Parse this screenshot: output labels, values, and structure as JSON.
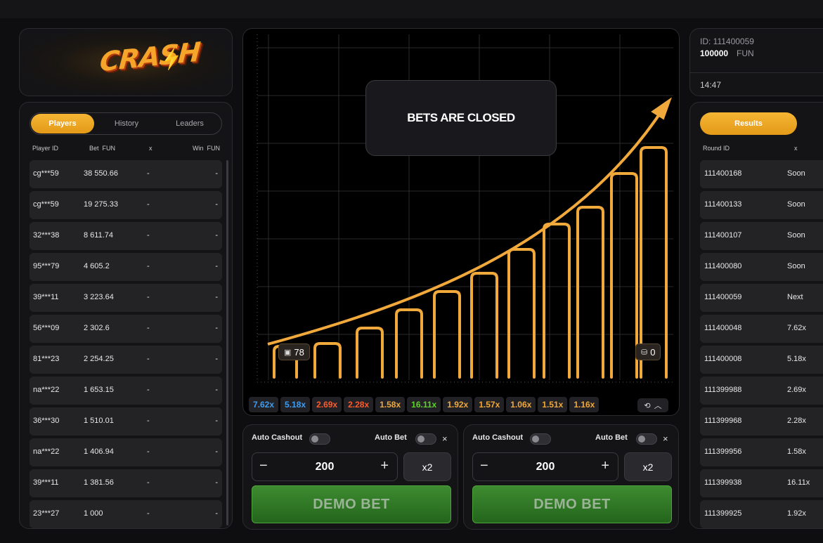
{
  "logo": {
    "text": "CRASH"
  },
  "players": {
    "tabs": [
      {
        "label": "Players",
        "active": true
      },
      {
        "label": "History",
        "active": false
      },
      {
        "label": "Leaders",
        "active": false
      }
    ],
    "headers": {
      "player_id": "Player ID",
      "bet": "Bet  FUN",
      "x": "x",
      "win": "Win  FUN"
    },
    "rows": [
      {
        "id": "cg***59",
        "bet": "38 550.66",
        "x": "-",
        "win": "-"
      },
      {
        "id": "cg***59",
        "bet": "19 275.33",
        "x": "-",
        "win": "-"
      },
      {
        "id": "32***38",
        "bet": "8 611.74",
        "x": "-",
        "win": "-"
      },
      {
        "id": "95***79",
        "bet": "4 605.2",
        "x": "-",
        "win": "-"
      },
      {
        "id": "39***11",
        "bet": "3 223.64",
        "x": "-",
        "win": "-"
      },
      {
        "id": "56***09",
        "bet": "2 302.6",
        "x": "-",
        "win": "-"
      },
      {
        "id": "81***23",
        "bet": "2 254.25",
        "x": "-",
        "win": "-"
      },
      {
        "id": "na***22",
        "bet": "1 653.15",
        "x": "-",
        "win": "-"
      },
      {
        "id": "36***30",
        "bet": "1 510.01",
        "x": "-",
        "win": "-"
      },
      {
        "id": "na***22",
        "bet": "1 406.94",
        "x": "-",
        "win": "-"
      },
      {
        "id": "39***11",
        "bet": "1 381.56",
        "x": "-",
        "win": "-"
      },
      {
        "id": "23***27",
        "bet": "1 000",
        "x": "-",
        "win": "-"
      }
    ]
  },
  "game": {
    "status": "BETS ARE CLOSED",
    "players_count": "78",
    "cashout_count": "0",
    "colors": {
      "accent": "#f0a83a",
      "line": "#f2a93b"
    },
    "history": [
      {
        "value": "7.62x",
        "color": "#3d9df3"
      },
      {
        "value": "5.18x",
        "color": "#3d9df3"
      },
      {
        "value": "2.69x",
        "color": "#ff5a2a"
      },
      {
        "value": "2.28x",
        "color": "#ff5a2a"
      },
      {
        "value": "1.58x",
        "color": "#f0a83a"
      },
      {
        "value": "16.11x",
        "color": "#5fd22a"
      },
      {
        "value": "1.92x",
        "color": "#f0a83a"
      },
      {
        "value": "1.57x",
        "color": "#f0a83a"
      },
      {
        "value": "1.06x",
        "color": "#f0a83a"
      },
      {
        "value": "1.51x",
        "color": "#f0a83a"
      },
      {
        "value": "1.16x",
        "color": "#f0a83a"
      }
    ]
  },
  "bet_panels": [
    {
      "auto_cashout": "Auto Cashout",
      "auto_bet": "Auto Bet",
      "close": "×",
      "minus": "−",
      "plus": "+",
      "amount": "200",
      "double": "x2",
      "button": "DEMO BET"
    },
    {
      "auto_cashout": "Auto Cashout",
      "auto_bet": "Auto Bet",
      "close": "×",
      "minus": "−",
      "plus": "+",
      "amount": "200",
      "double": "x2",
      "button": "DEMO BET"
    }
  ],
  "account": {
    "id": "ID: 111400059",
    "balance": "100000",
    "currency": "FUN",
    "time": "14:47"
  },
  "results": {
    "tab": "Results",
    "headers": {
      "round_id": "Round ID",
      "x": "x"
    },
    "rows": [
      {
        "round": "111400168",
        "x": "Soon"
      },
      {
        "round": "111400133",
        "x": "Soon"
      },
      {
        "round": "111400107",
        "x": "Soon"
      },
      {
        "round": "111400080",
        "x": "Soon"
      },
      {
        "round": "111400059",
        "x": "Next"
      },
      {
        "round": "111400048",
        "x": "7.62x"
      },
      {
        "round": "111400008",
        "x": "5.18x"
      },
      {
        "round": "111399988",
        "x": "2.69x"
      },
      {
        "round": "111399968",
        "x": "2.28x"
      },
      {
        "round": "111399956",
        "x": "1.58x"
      },
      {
        "round": "111399938",
        "x": "16.11x"
      },
      {
        "round": "111399925",
        "x": "1.92x"
      }
    ]
  }
}
